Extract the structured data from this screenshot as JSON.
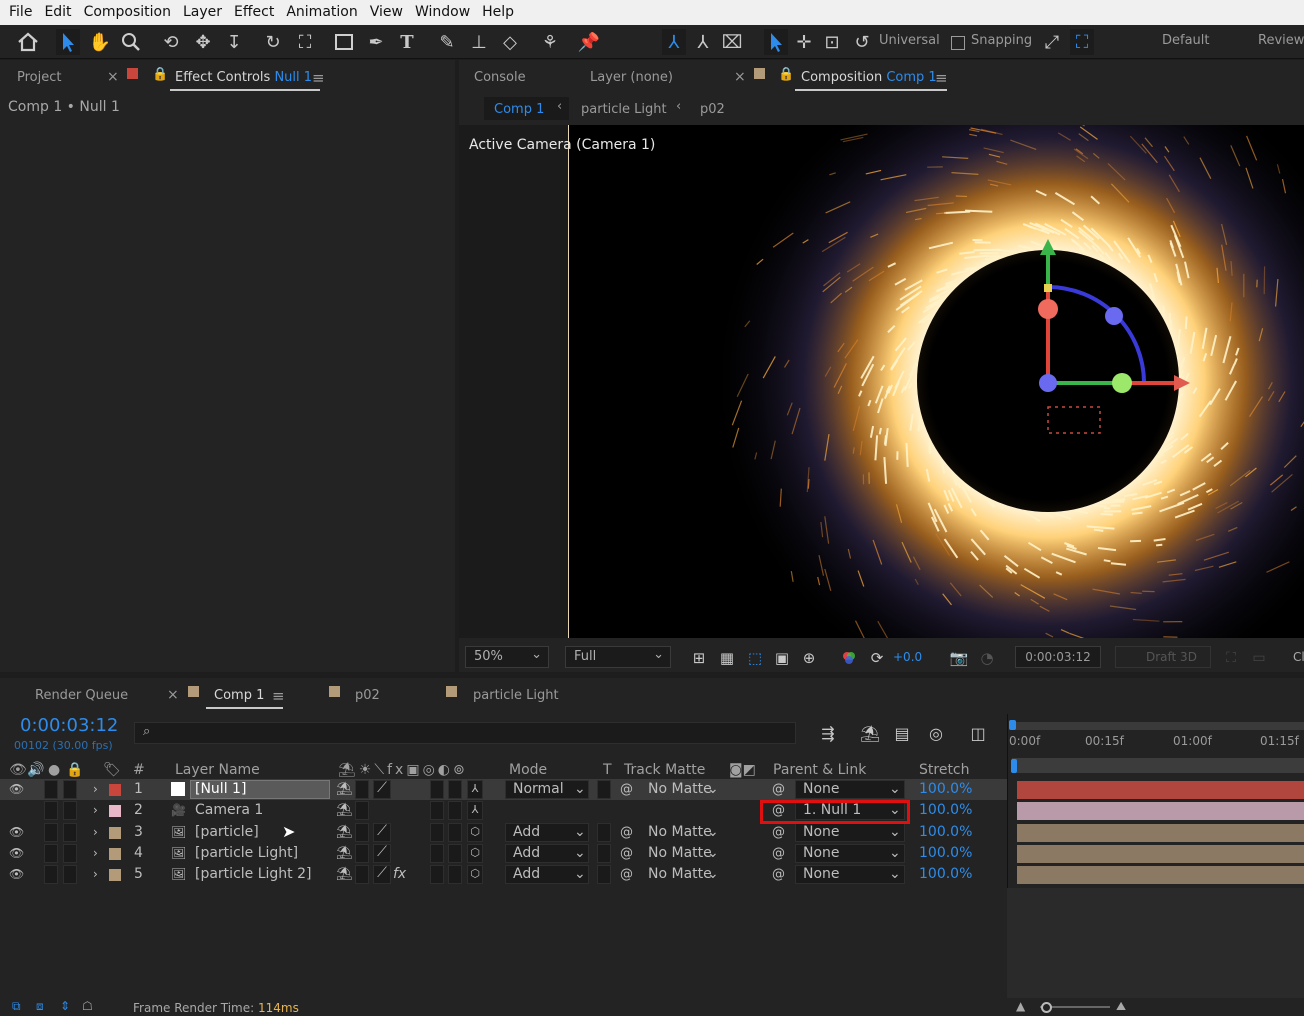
{
  "menu": [
    "File",
    "Edit",
    "Composition",
    "Layer",
    "Effect",
    "Animation",
    "View",
    "Window",
    "Help"
  ],
  "toolbar": {
    "universal_label": "Universal",
    "snapping_label": "Snapping",
    "workspace_default": "Default",
    "workspace_review": "Review"
  },
  "left_panel": {
    "tab_project": "Project",
    "tab_effect_controls": "Effect Controls",
    "effect_target": "Null 1",
    "breadcrumb": "Comp 1 • Null 1"
  },
  "right_panel": {
    "tab_console": "Console",
    "tab_layer": "Layer (none)",
    "tab_composition": "Composition",
    "comp_name": "Comp 1",
    "flow": [
      "Comp 1",
      "particle Light",
      "p02"
    ],
    "viewer_label": "Active Camera (Camera 1)",
    "zoom": "50%",
    "resolution": "Full",
    "exposure": "+0.0",
    "timecode": "0:00:03:12",
    "draft3d": "Draft 3D",
    "cut_label": "Cl"
  },
  "timeline": {
    "tabs": [
      "Render Queue",
      "Comp 1",
      "p02",
      "particle Light"
    ],
    "timecode": "0:00:03:12",
    "frame_info": "00102 (30.00 fps)",
    "search_placeholder": "",
    "headers": {
      "num": "#",
      "layer_name": "Layer Name",
      "mode": "Mode",
      "t": "T",
      "track_matte": "Track Matte",
      "parent_link": "Parent & Link",
      "stretch": "Stretch"
    },
    "ruler": [
      "0:00f",
      "00:15f",
      "01:00f",
      "01:15f"
    ],
    "layers": [
      {
        "num": "1",
        "name": "[Null 1]",
        "color": "#c8463b",
        "mode": "Normal",
        "matte": "No Matte",
        "parent": "None",
        "stretch": "100.0%",
        "bar": "#b0463d"
      },
      {
        "num": "2",
        "name": "Camera 1",
        "color": "#e9b7c7",
        "mode": "",
        "matte": "",
        "parent": "1. Null 1",
        "stretch": "100.0%",
        "bar": "#b99aa9"
      },
      {
        "num": "3",
        "name": "[particle]",
        "color": "#b39a78",
        "mode": "Add",
        "matte": "No Matte",
        "parent": "None",
        "stretch": "100.0%",
        "bar": "#8c7963"
      },
      {
        "num": "4",
        "name": "[particle Light]",
        "color": "#b39a78",
        "mode": "Add",
        "matte": "No Matte",
        "parent": "None",
        "stretch": "100.0%",
        "bar": "#8c7963"
      },
      {
        "num": "5",
        "name": "[particle Light 2]",
        "color": "#b39a78",
        "mode": "Add",
        "matte": "No Matte",
        "parent": "None",
        "stretch": "100.0%",
        "bar": "#8c7963"
      }
    ]
  },
  "status": {
    "label": "Frame Render Time:",
    "value": "114ms"
  }
}
